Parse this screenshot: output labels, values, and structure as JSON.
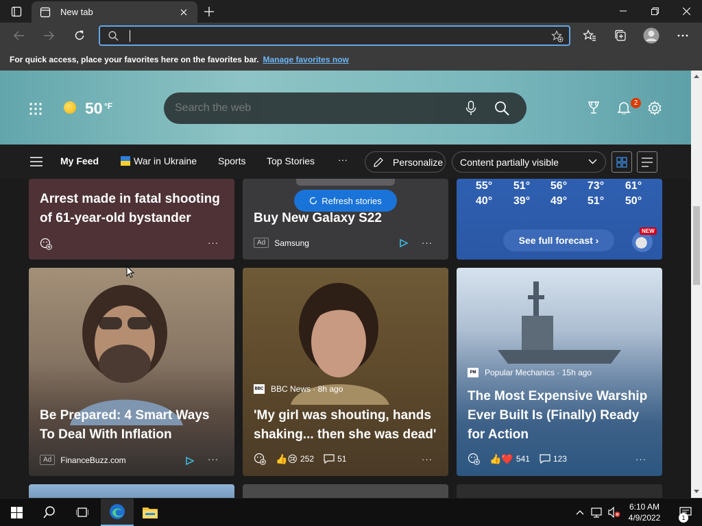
{
  "browser": {
    "tab_title": "New tab",
    "address_value": "",
    "favorites_bar_text": "For quick access, place your favorites here on the favorites bar.",
    "favorites_bar_link": "Manage favorites now"
  },
  "hero": {
    "temperature": "50",
    "temperature_unit": "°F",
    "search_placeholder": "Search the web",
    "notification_count": "2"
  },
  "nav": {
    "items": [
      "My Feed",
      "War in Ukraine",
      "Sports",
      "Top Stories",
      "···"
    ],
    "personalize_label": "Personalize",
    "visibility_label": "Content partially visible"
  },
  "cards": {
    "arrest": {
      "title_line1": "Arrest made in fatal shooting",
      "title_line2": "of 61-year-old bystander",
      "more": "···"
    },
    "galaxy": {
      "title": "Buy New Galaxy S22",
      "ad_label": "Ad",
      "source": "Samsung",
      "more": "···"
    },
    "refresh_label": "Refresh stories",
    "forecast": {
      "highs": [
        "55°",
        "51°",
        "56°",
        "73°",
        "61°"
      ],
      "lows": [
        "40°",
        "39°",
        "49°",
        "51°",
        "50°"
      ],
      "button_label": "See full forecast ›",
      "new_badge": "NEW"
    },
    "inflation": {
      "title_line1": "Be Prepared: 4 Smart Ways",
      "title_line2": "To Deal With Inflation",
      "ad_label": "Ad",
      "source": "FinanceBuzz.com",
      "more": "···"
    },
    "bbc": {
      "source": "BBC News · 8h ago",
      "logo": "BBC",
      "title_line1": "'My girl was shouting, hands",
      "title_line2": "shaking... then she was dead'",
      "reactions": "252",
      "comments": "51",
      "more": "···"
    },
    "warship": {
      "source": "Popular Mechanics · 15h ago",
      "logo": "PM",
      "title_line1": "The Most Expensive Warship",
      "title_line2": "Ever Built Is (Finally) Ready",
      "title_line3": "for Action",
      "reactions": "541",
      "comments": "123",
      "more": "···"
    }
  },
  "taskbar": {
    "time": "6:10 AM",
    "date": "4/9/2022",
    "notification_count": "1"
  },
  "colors": {
    "accent": "#65a6e8",
    "link": "#6fb5f4",
    "refresh": "#1a73d8"
  }
}
